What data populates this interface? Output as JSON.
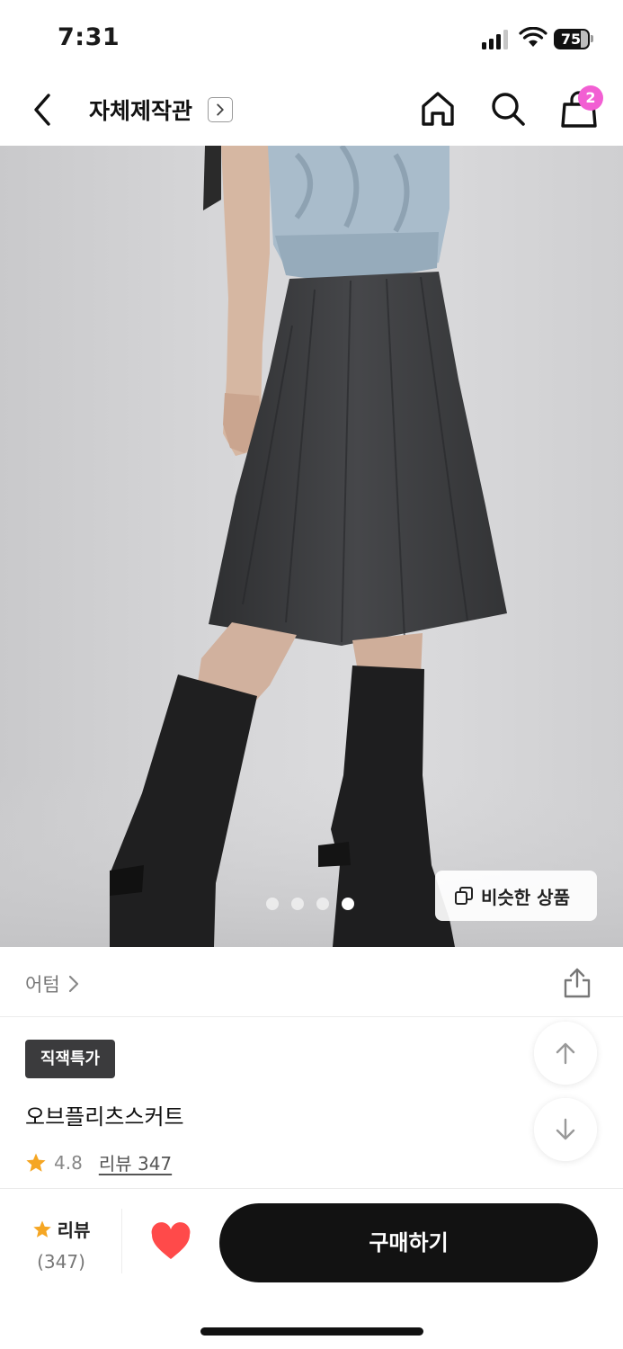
{
  "status_bar": {
    "time": "7:31",
    "battery": "75"
  },
  "header": {
    "store_name": "자체제작관",
    "cart_count": "2",
    "icons": {
      "back": "chevron-left-icon",
      "store_link": "chevron-right-box-icon",
      "home": "home-icon",
      "search": "search-icon",
      "cart": "shopping-bag-icon"
    }
  },
  "gallery": {
    "image_count": 4,
    "active_index": 4,
    "similar_label": "비슷한 상품"
  },
  "category": {
    "label": "어텀",
    "share_icon": "share-icon"
  },
  "product": {
    "badge": "직잭특가",
    "name": "오브플리츠스커트",
    "rating": "4.8",
    "review_link": "리뷰 347"
  },
  "bottom_bar": {
    "review_label": "리뷰",
    "review_count": "(347)",
    "buy_label": "구매하기",
    "liked": true
  },
  "colors": {
    "accent_badge": "#f25fd3",
    "star": "#f5a623",
    "heart": "#ff4a4a",
    "buy_button": "#121212"
  }
}
